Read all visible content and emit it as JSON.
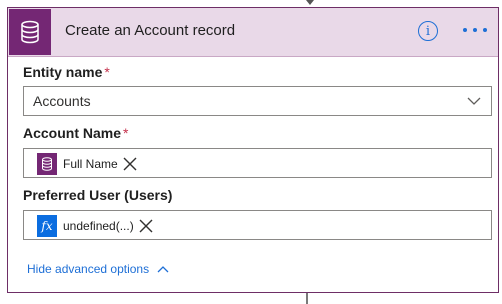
{
  "card": {
    "title": "Create an Account record",
    "header_icon": "database-icon",
    "info_icon": "info-icon",
    "info_glyph": "i",
    "more_icon": "more-ellipsis-icon",
    "accent_color": "#742774",
    "header_bg": "#e9d9e8"
  },
  "fields": {
    "entity": {
      "label": "Entity name",
      "required_mark": "*",
      "value": "Accounts"
    },
    "account_name": {
      "label": "Account Name",
      "required_mark": "*",
      "token": {
        "icon": "database-icon",
        "text": "Full Name"
      }
    },
    "preferred_user": {
      "label": "Preferred User (Users)",
      "token": {
        "icon": "fx-icon",
        "icon_text": "fx",
        "text": "undefined(...)"
      }
    }
  },
  "advanced": {
    "label": "Hide advanced options",
    "link_color": "#1e6fd6"
  }
}
